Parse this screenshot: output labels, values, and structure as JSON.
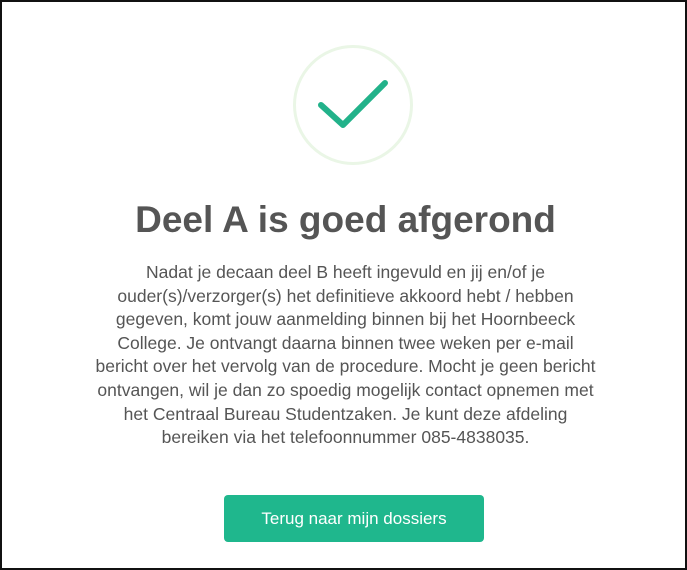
{
  "dialog": {
    "icon": "checkmark-icon",
    "title": "Deel A is goed afgerond",
    "message_lines": [
      "Nadat je decaan deel B heeft ingevuld en jij en/of je",
      "ouder(s)/verzorger(s) het definitieve akkoord hebt / hebben",
      "gegeven, komt jouw aanmelding binnen bij het Hoornbeeck",
      "College. Je ontvangt daarna binnen twee weken per e-mail",
      "bericht over het vervolg van de procedure. Mocht je geen bericht",
      "ontvangen, wil je dan zo spoedig mogelijk contact opnemen met",
      "het Centraal Bureau Studentzaken. Je kunt deze afdeling",
      "bereiken via het telefoonnummer 085-4838035."
    ],
    "button_label": "Terug naar mijn dossiers"
  },
  "colors": {
    "accent": "#1fb78d",
    "check": "#22b28a",
    "ring": "#eaf6e6",
    "text": "#555555"
  }
}
